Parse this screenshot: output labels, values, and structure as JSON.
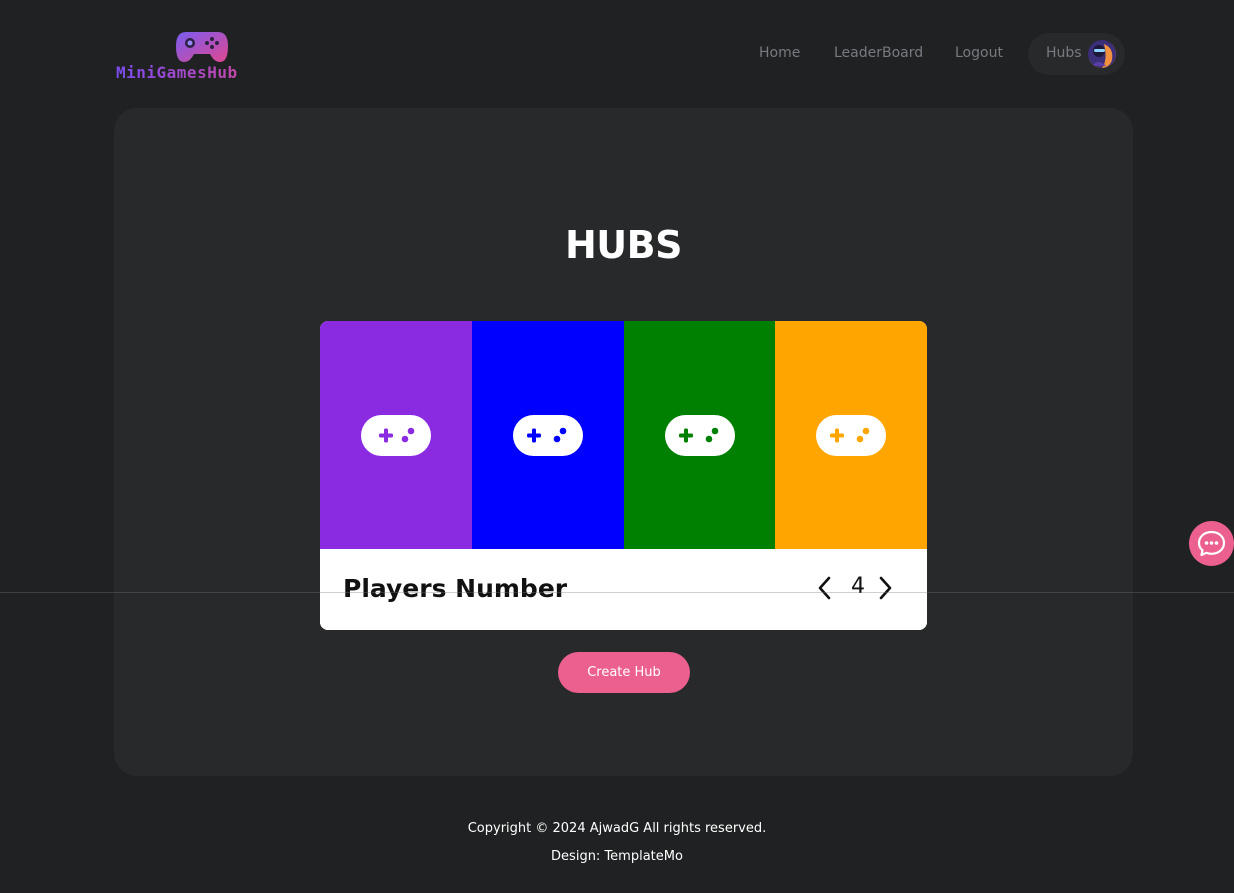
{
  "header": {
    "logo_text": "MiniGamesHub",
    "nav": {
      "home": "Home",
      "leaderboard": "LeaderBoard",
      "logout": "Logout",
      "hubs": "Hubs"
    }
  },
  "main": {
    "title": "HUBS",
    "swatches": [
      {
        "color": "#8a2be2",
        "icon": "gamepad-icon"
      },
      {
        "color": "#0000ff",
        "icon": "gamepad-icon"
      },
      {
        "color": "#008000",
        "icon": "gamepad-icon"
      },
      {
        "color": "#ffa500",
        "icon": "gamepad-icon"
      }
    ],
    "players_label": "Players Number",
    "players_count": "4",
    "create_button": "Create Hub"
  },
  "footer": {
    "copyright": "Copyright © 2024 AjwadG All rights reserved.",
    "design": "Design: TemplateMo"
  },
  "colors": {
    "background": "#1f2122",
    "panel": "#27292a",
    "accent": "#ec6090",
    "nav_text": "#777b80"
  }
}
